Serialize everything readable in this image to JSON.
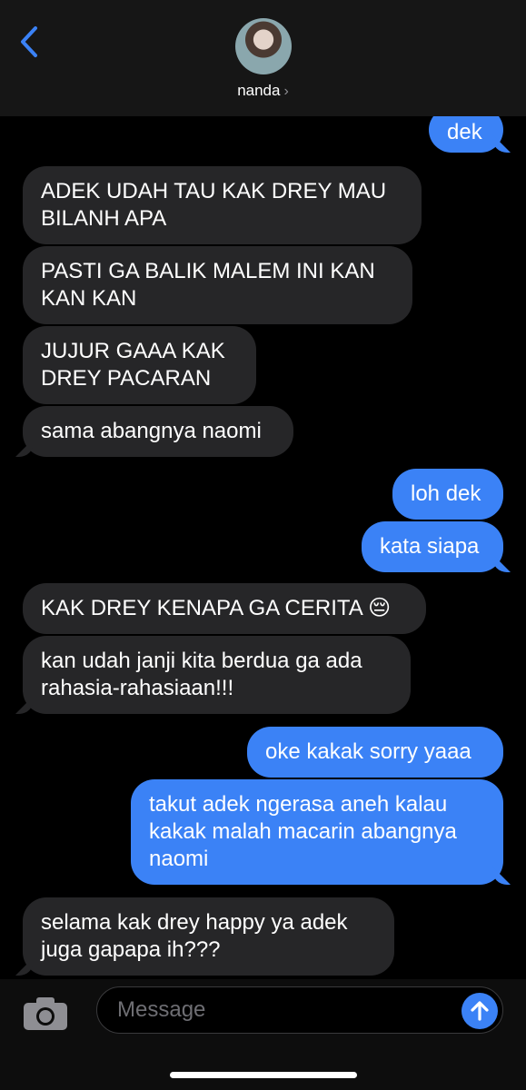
{
  "header": {
    "contact_name": "nanda",
    "chevron": "›",
    "back_icon": "chevron-left-icon",
    "colors": {
      "accent": "#3b82f6",
      "header_bg": "#161616"
    }
  },
  "messages": [
    {
      "direction": "out",
      "text": "dek"
    },
    {
      "direction": "in",
      "text": "ADEK UDAH TAU KAK DREY MAU BILANH APA"
    },
    {
      "direction": "in",
      "text": "PASTI GA BALIK MALEM INI KAN KAN KAN"
    },
    {
      "direction": "in",
      "text": "JUJUR GAAA KAK DREY PACARAN"
    },
    {
      "direction": "in",
      "text": "sama abangnya naomi"
    },
    {
      "direction": "out",
      "text": "loh dek"
    },
    {
      "direction": "out",
      "text": "kata siapa"
    },
    {
      "direction": "in",
      "text": "KAK DREY KENAPA GA CERITA 😔"
    },
    {
      "direction": "in",
      "text": "kan udah janji kita berdua ga ada rahasia-rahasiaan!!!"
    },
    {
      "direction": "out",
      "text": "oke kakak sorry yaaa"
    },
    {
      "direction": "out",
      "text": "takut adek ngerasa aneh kalau kakak malah macarin abangnya naomi"
    },
    {
      "direction": "in",
      "text": "selama kak drey happy ya adek juga gapapa ih???"
    }
  ],
  "composer": {
    "placeholder": "Message",
    "camera_icon": "camera-icon",
    "send_icon": "arrow-up-icon"
  }
}
